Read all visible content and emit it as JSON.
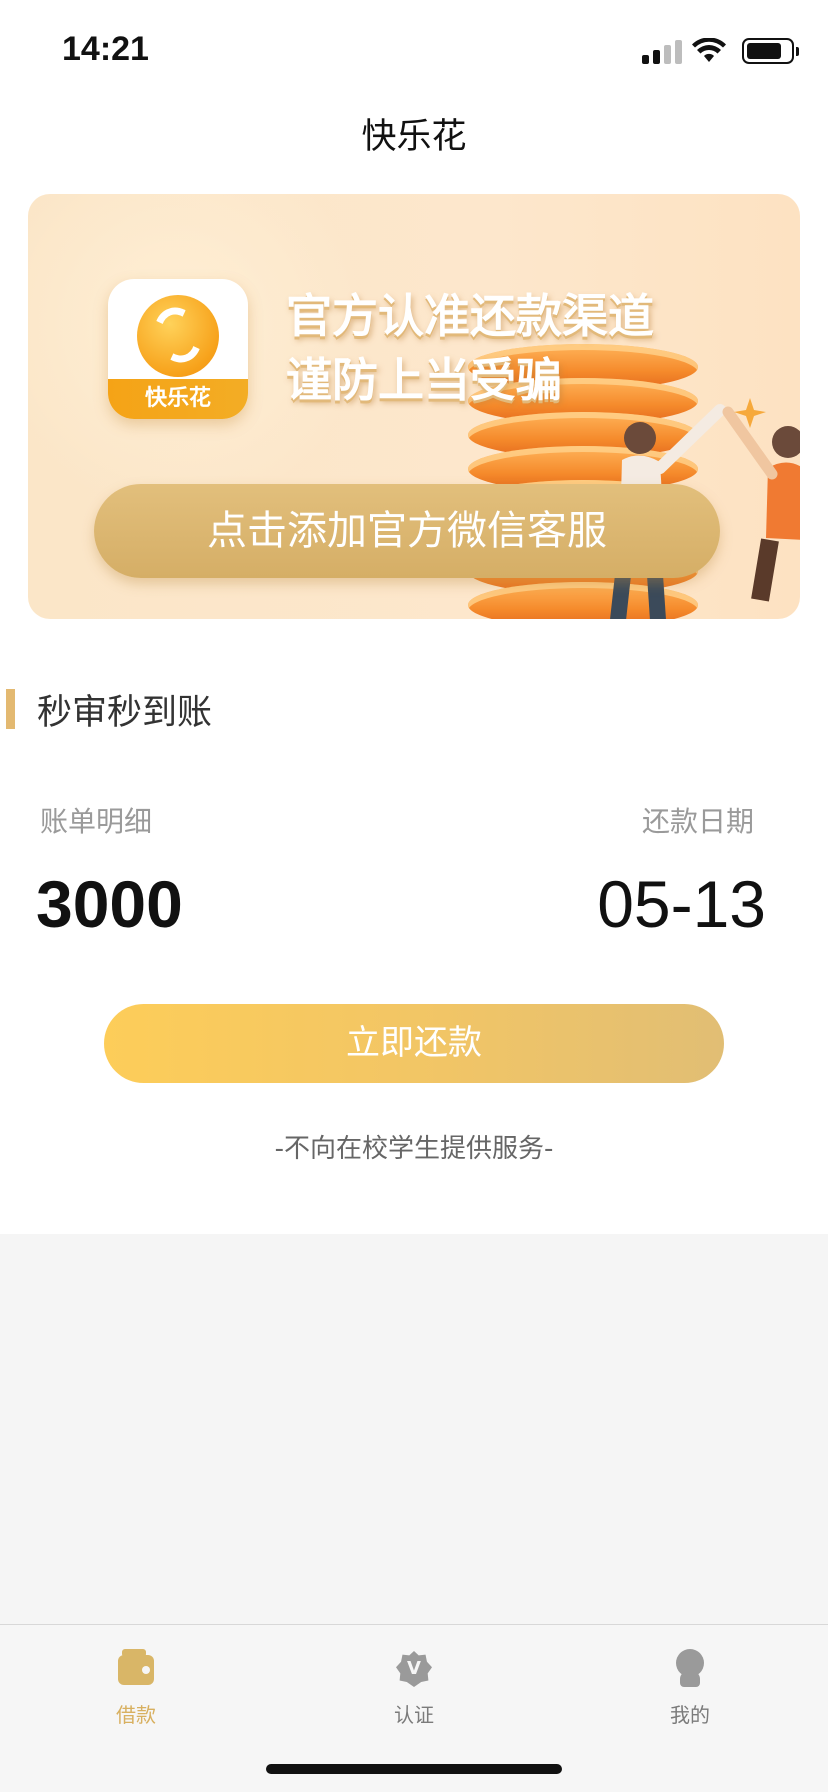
{
  "status_bar": {
    "time": "14:21"
  },
  "page": {
    "title": "快乐花"
  },
  "banner": {
    "logo_text": "快乐花",
    "headline_line1": "官方认准还款渠道",
    "headline_line2": "谨防上当受骗",
    "cta_label": "点击添加官方微信客服"
  },
  "section": {
    "title": "秒审秒到账"
  },
  "bill": {
    "detail_label": "账单明细",
    "amount": "3000",
    "due_label": "还款日期",
    "due_date": "05-13"
  },
  "repay_button": {
    "label": "立即还款"
  },
  "notice": {
    "text": "-不向在校学生提供服务-"
  },
  "tab_bar": {
    "items": [
      {
        "label": "借款",
        "icon": "wallet-icon",
        "active": true
      },
      {
        "label": "认证",
        "icon": "verify-badge-icon",
        "active": false
      },
      {
        "label": "我的",
        "icon": "profile-icon",
        "active": false
      }
    ],
    "active_color": "#d8b060",
    "inactive_color": "#7b7b7b"
  },
  "colors": {
    "accent_gold": "#e3b971",
    "repay_gradient_start": "#fdcd59",
    "repay_gradient_end": "#e1be74"
  }
}
